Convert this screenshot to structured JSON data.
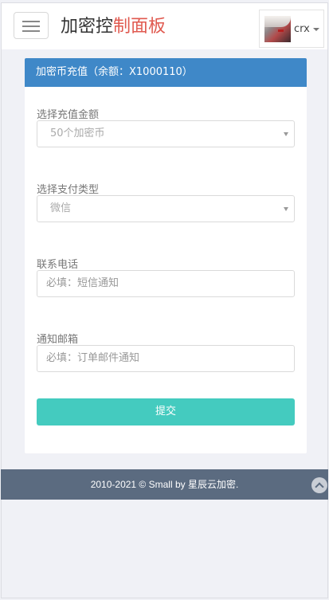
{
  "header": {
    "brand_main": "加密控",
    "brand_accent": "制面板",
    "username": "crx"
  },
  "panel": {
    "title": "加密币充值（余额：X1000110）",
    "amount_label": "选择充值金额",
    "amount_selected": "50个加密币",
    "pay_type_label": "选择支付类型",
    "pay_type_selected": "微信",
    "phone_label": "联系电话",
    "phone_placeholder": "必填：短信通知",
    "email_label": "通知邮箱",
    "email_placeholder": "必填：订单邮件通知",
    "submit_label": "提交"
  },
  "footer": {
    "copyright": "2010-2021 © Small by 星辰云加密."
  },
  "icons": {
    "menu": "menu-icon",
    "back_to_top": "chevron-up-icon",
    "dropdown": "caret-down-icon"
  },
  "colors": {
    "brand_accent": "#e0594f",
    "panel_header": "#3f88c8",
    "submit": "#44cbbf",
    "footer": "#5b6b80"
  }
}
